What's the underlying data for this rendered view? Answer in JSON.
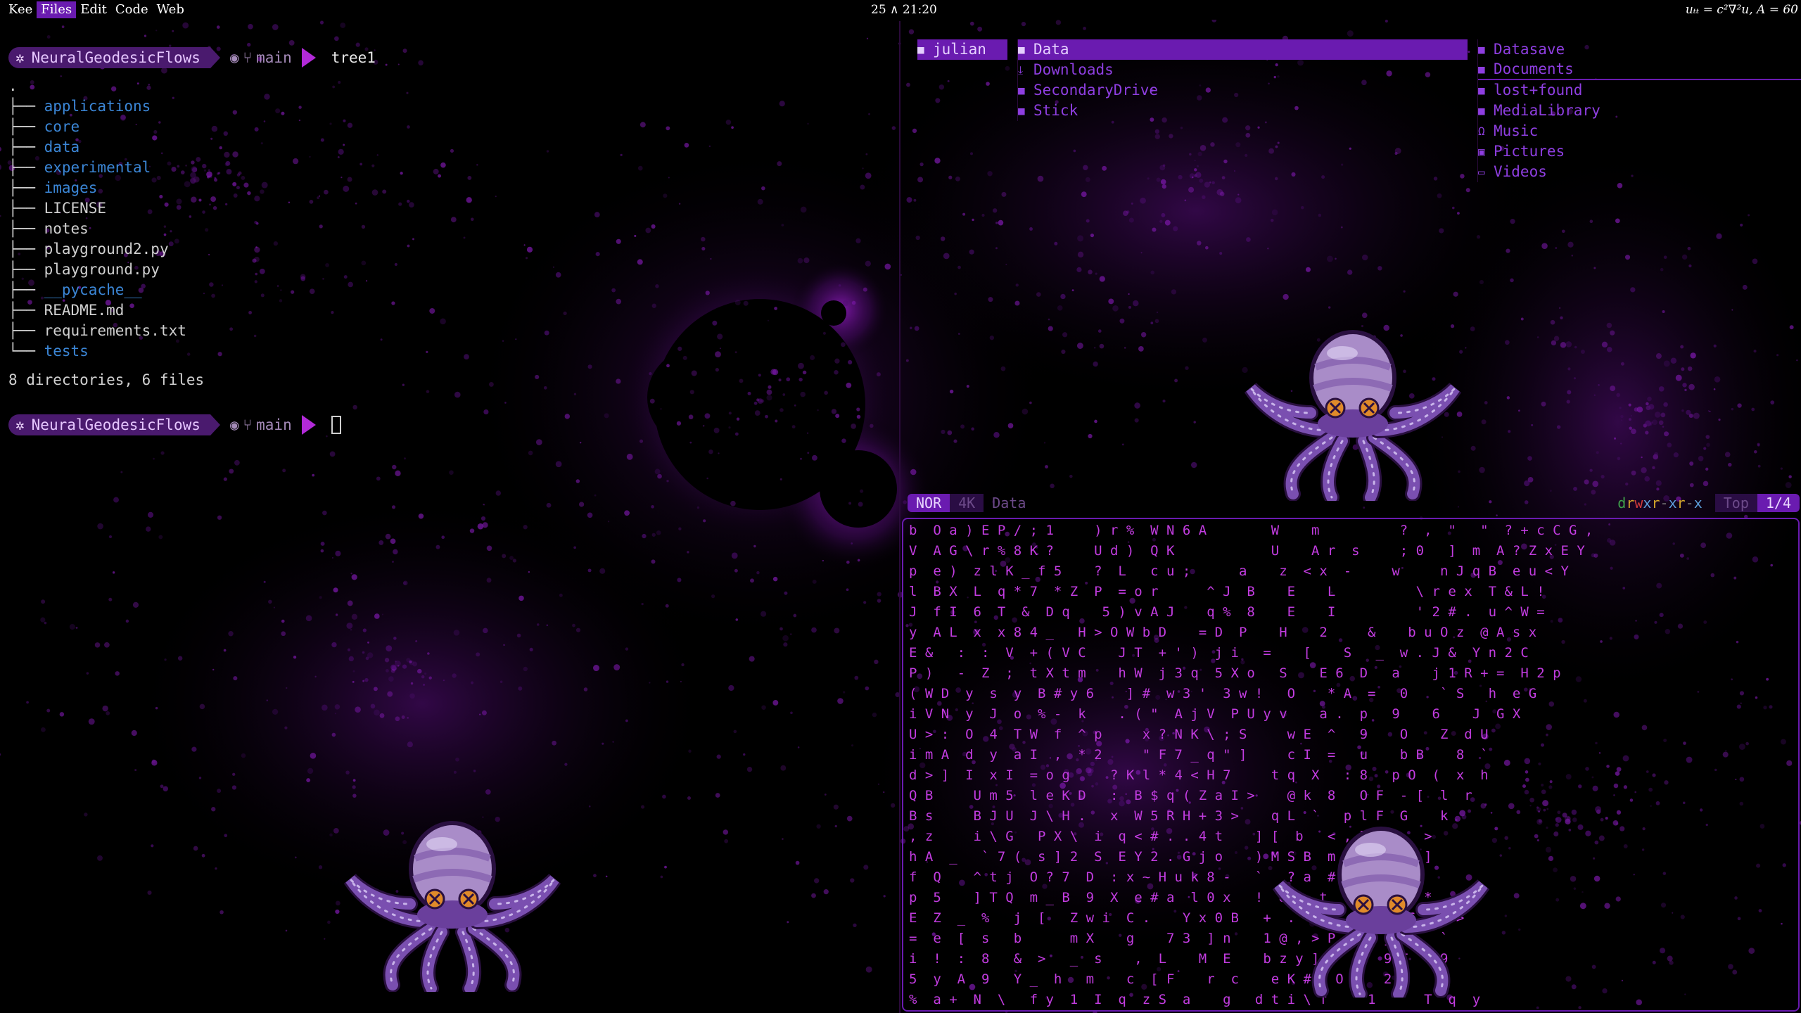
{
  "menu": {
    "items": [
      {
        "label": "Kee",
        "active": false
      },
      {
        "label": "Files",
        "active": true
      },
      {
        "label": "Edit",
        "active": false
      },
      {
        "label": "Code",
        "active": false
      },
      {
        "label": "Web",
        "active": false
      }
    ]
  },
  "clock": "25 ∧ 21:20",
  "formula": "uₜₜ = c²∇²u, A = 60",
  "terminal": {
    "dir": "NeuralGeodesicFlows",
    "branch": "main",
    "command": "tree1",
    "root": ".",
    "tree": [
      {
        "name": "applications",
        "type": "dir"
      },
      {
        "name": "core",
        "type": "dir"
      },
      {
        "name": "data",
        "type": "dir"
      },
      {
        "name": "experimental",
        "type": "dir"
      },
      {
        "name": "images",
        "type": "dir"
      },
      {
        "name": "LICENSE",
        "type": "file"
      },
      {
        "name": "notes",
        "type": "file"
      },
      {
        "name": "playground2.py",
        "type": "file"
      },
      {
        "name": "playground.py",
        "type": "file"
      },
      {
        "name": "__pycache__",
        "type": "dir"
      },
      {
        "name": "README.md",
        "type": "file"
      },
      {
        "name": "requirements.txt",
        "type": "file"
      },
      {
        "name": "tests",
        "type": "dir"
      }
    ],
    "summary": "8 directories, 6 files"
  },
  "file_manager": {
    "parent": [
      {
        "name": "julian",
        "icon": "folder-icon",
        "selected": true
      }
    ],
    "current": [
      {
        "name": "Data",
        "icon": "folder-icon",
        "selected": true
      },
      {
        "name": "Downloads",
        "icon": "download-icon",
        "selected": false
      },
      {
        "name": "SecondaryDrive",
        "icon": "folder-icon",
        "selected": false
      },
      {
        "name": "Stick",
        "icon": "folder-icon",
        "selected": false
      }
    ],
    "preview": [
      {
        "name": "Datasave",
        "icon": "folder-icon"
      },
      {
        "name": "Documents",
        "icon": "folder-icon"
      },
      {
        "name": "lost+found",
        "icon": "folder-icon"
      },
      {
        "name": "MediaLibrary",
        "icon": "folder-icon"
      },
      {
        "name": "Music",
        "icon": "headphones-icon"
      },
      {
        "name": "Pictures",
        "icon": "image-icon"
      },
      {
        "name": "Videos",
        "icon": "video-icon"
      }
    ]
  },
  "status": {
    "mode": "NOR",
    "size": "4K",
    "name": "Data",
    "permissions": "drwxr-xr-x",
    "position": "Top",
    "count": "1/4"
  },
  "matrix": {
    "rows": [
      "b  O a ) E P / ; 1     ) r %  W N 6 A        W    m          ?  ,  \"   \"  ? + c C G ,",
      "V  A G \\ r % 8 K ?     U d )  Q K            U    A r  s     ; 0   ]  m  A ? Z x E Y",
      "p  e )  z l K _ f 5    ?  L   c u ;      a    z  < x  -     w     n J q B  e u < Y",
      "l  B X  L  q * 7  * Z  P  = o r      ^ J  B    E    L          \\ r e x  T & L !",
      "J  f I  6  T  &  D q    5 ) v A J    q %  8    E    I          ' 2 # .  u ^ W =",
      "y  A L  x  x 8 4 _   H > O W b D    = D  P    H    2     &    b u O z  @ A s x",
      "E &   :  :  V  + ( V C    J T  + ' )  j i   =    [    S   _  w . J &  Y n 2 C",
      "P )   -  Z  ;  t X t m    h W  j 3 q  5 X o   S    E 6  D   a    j 1 R + =  H 2 p",
      "( W D  y  s  y  B # y 6    ] #  w 3 '  3 w !   O    * A  =   0    ` S   h  e G",
      "i V N  y  J  o  % -  k    . ( \"  A j V  P U y v    a .  p   9    6    J  G X",
      "U > :  O  4  T W  f  ^ p     x ? N K \\ ; S     w E  ^   9    O    Z  d U",
      "i m A  d  y  a I  ,  * 2     \" F 7 _ q \" ]     c I  =   u    b B    8  `",
      "d > ]  I  x I  = o g     ? K l * 4 < H 7     t q  X   : 8   p O  (  x  h",
      "Q B     U m 5  l e K D   :  B $ q ( Z a I >    @ k  8   O F  - [  l  r",
      "B s     B J U  J \\ H .   x  W 5 R H + 3 >    q L  `   p l F  G    k",
      ", z     i \\ G   P X \\  i  q < # . . 4 t    ] [  b   < , l  g    >",
      "h A  _   ` 7 (  s ] 2  S  E Y 2 . G j o    ) M S B  m Q ?  1    ]",
      "f  Q    ^ t j  O ? 7  D  : x ~ H u k 8 -   `   ? a  #  8  x    j",
      "p  5    ] T Q  m _ B  9  X  e # a  l 0 x   !  & ,  t  l A u  F  *",
      "E  Z  _  %   j  [   Z w i  C .    Y x 0 B   +  . ^ i   .  T j 6  Y  >",
      "=  e  [  s   b      m X    g    7 3  ] n    1 @ , > P      j *    `",
      "i  !  :  8   &  >   _  s    ,  L    M  E    b z y ] 3      9 T    9",
      "5  y  A  9   Y _  h   m    c  [ F    r  c    e K # i O     2      C",
      "%  a +  N  \\   f y  1  I  q  z S  a    g   d t i \\ f     1      T  q  y"
    ]
  },
  "colors": {
    "accent": "#6a1bb0",
    "folder": "#8e3ee0",
    "dir_blue": "#3b86d6",
    "matrix": "#c23ce0"
  }
}
